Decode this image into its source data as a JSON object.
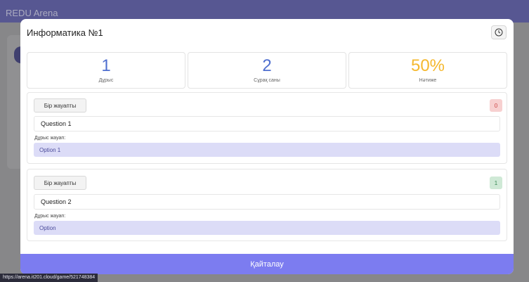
{
  "background": {
    "brand": "REDU Arena",
    "status_url": "https://arena.it201.cloud/game/521748384"
  },
  "modal": {
    "title": "Информатика №1",
    "history_icon": "clock-icon"
  },
  "stats": [
    {
      "value": "1",
      "label": "Дұрыс"
    },
    {
      "value": "2",
      "label": "Сұрақ саны"
    },
    {
      "value": "50%",
      "label": "Нәтиже"
    }
  ],
  "questions": [
    {
      "type": "Бір жауапты",
      "badge": "0",
      "text": "Question 1",
      "answer_label": "Дұрыс жауап:",
      "answer": "Option 1"
    },
    {
      "type": "Бір жауапты",
      "badge": "1",
      "text": "Question 2",
      "answer_label": "Дұрыс жауап:",
      "answer": "Option"
    }
  ],
  "retry_label": "Қайталау",
  "colors": {
    "accent": "#7c7cf0",
    "stat_blue": "#4f6fcf",
    "stat_orange": "#f5b82e",
    "answer_bg": "#dcdcf7",
    "badge_red": "#f7d0d0",
    "badge_green": "#cfe9d6"
  }
}
